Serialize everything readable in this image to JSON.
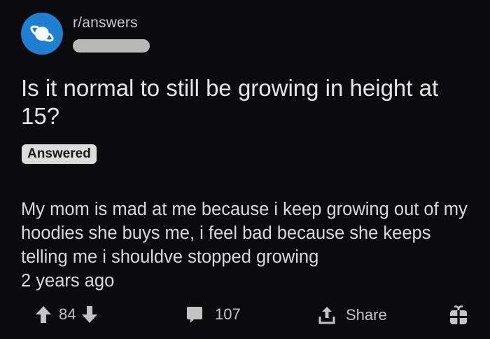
{
  "post": {
    "subreddit": "r/answers",
    "title": "Is it normal to still be growing in height at 15?",
    "flair": "Answered",
    "body": "My mom is mad at me because i keep growing out of my hoodies she buys me, i feel bad because she keeps telling me i shouldve stopped growing",
    "age": "2 years ago"
  },
  "actions": {
    "upvote_icon": "arrow-up-icon",
    "vote_count": "84",
    "downvote_icon": "arrow-down-icon",
    "comment_icon": "comment-bubble-icon",
    "comment_count": "107",
    "share_icon": "share-icon",
    "share_label": "Share",
    "award_icon": "gift-icon"
  },
  "colors": {
    "background": "#0b0b0d",
    "avatar": "#1f7fd1",
    "text": "#d7dadc",
    "badge": "#dcdcdc"
  }
}
